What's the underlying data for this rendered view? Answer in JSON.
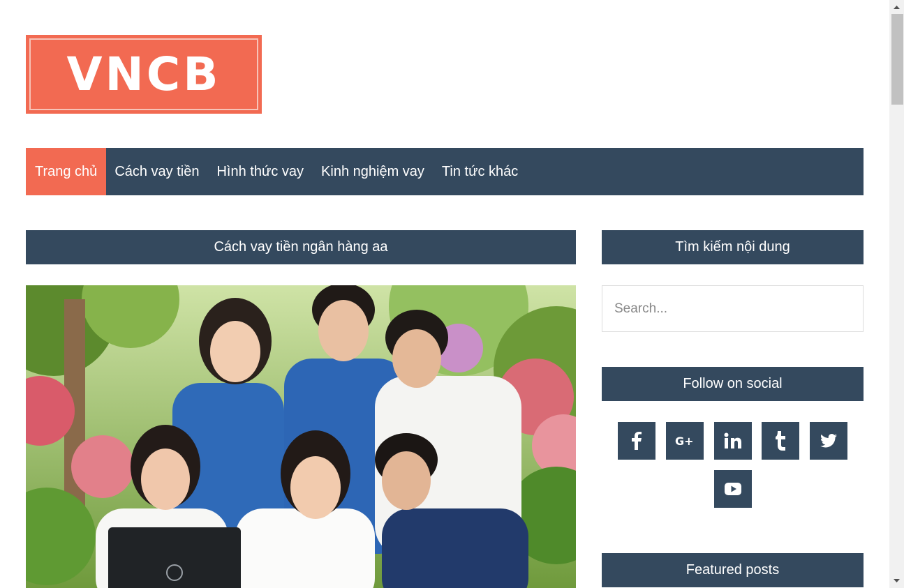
{
  "site": {
    "logo_text": "VNCB",
    "brand_color": "#f26a52",
    "dark_color": "#34495e"
  },
  "nav": {
    "items": [
      {
        "label": "Trang chủ",
        "active": true
      },
      {
        "label": "Cách vay tiền",
        "active": false
      },
      {
        "label": "Hình thức vay",
        "active": false
      },
      {
        "label": "Kinh nghiệm vay",
        "active": false
      },
      {
        "label": "Tin tức khác",
        "active": false
      }
    ]
  },
  "post": {
    "title": "Cách vay tiền ngân hàng aa",
    "image_alt": "Nhóm sinh viên tạo hình trái tim bằng tay bên máy tính xách tay"
  },
  "sidebar": {
    "search_title": "Tìm kiếm nội dung",
    "search_placeholder": "Search...",
    "social_title": "Follow on social",
    "social_icons": [
      "facebook-icon",
      "google-plus-icon",
      "linkedin-icon",
      "tumblr-icon",
      "twitter-icon",
      "youtube-icon"
    ],
    "featured_title": "Featured posts"
  }
}
